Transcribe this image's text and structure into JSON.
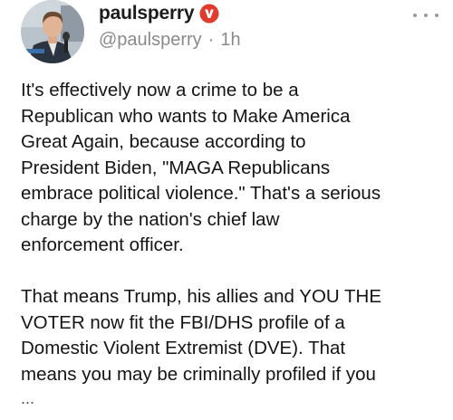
{
  "post": {
    "username": "paulsperry",
    "badge_icon": "verified-badge-icon",
    "badge_color": "#e03b2f",
    "handle": "@paulsperry",
    "separator": "·",
    "time": "1h",
    "more_icon": "more-options-icon",
    "paragraph1": [
      "It's effectively now a crime to be a",
      "Republican who wants to Make America",
      "Great Again, because according to",
      "President Biden, \"MAGA Republicans",
      "embrace political violence.\" That's a serious",
      "charge by the nation's chief law",
      "enforcement officer."
    ],
    "paragraph2": [
      "That means Trump, his allies and YOU THE",
      "VOTER now fit the FBI/DHS profile of a",
      "Domestic Violent Extremist (DVE). That",
      "means you may be criminally profiled if you"
    ],
    "truncation": "..."
  }
}
